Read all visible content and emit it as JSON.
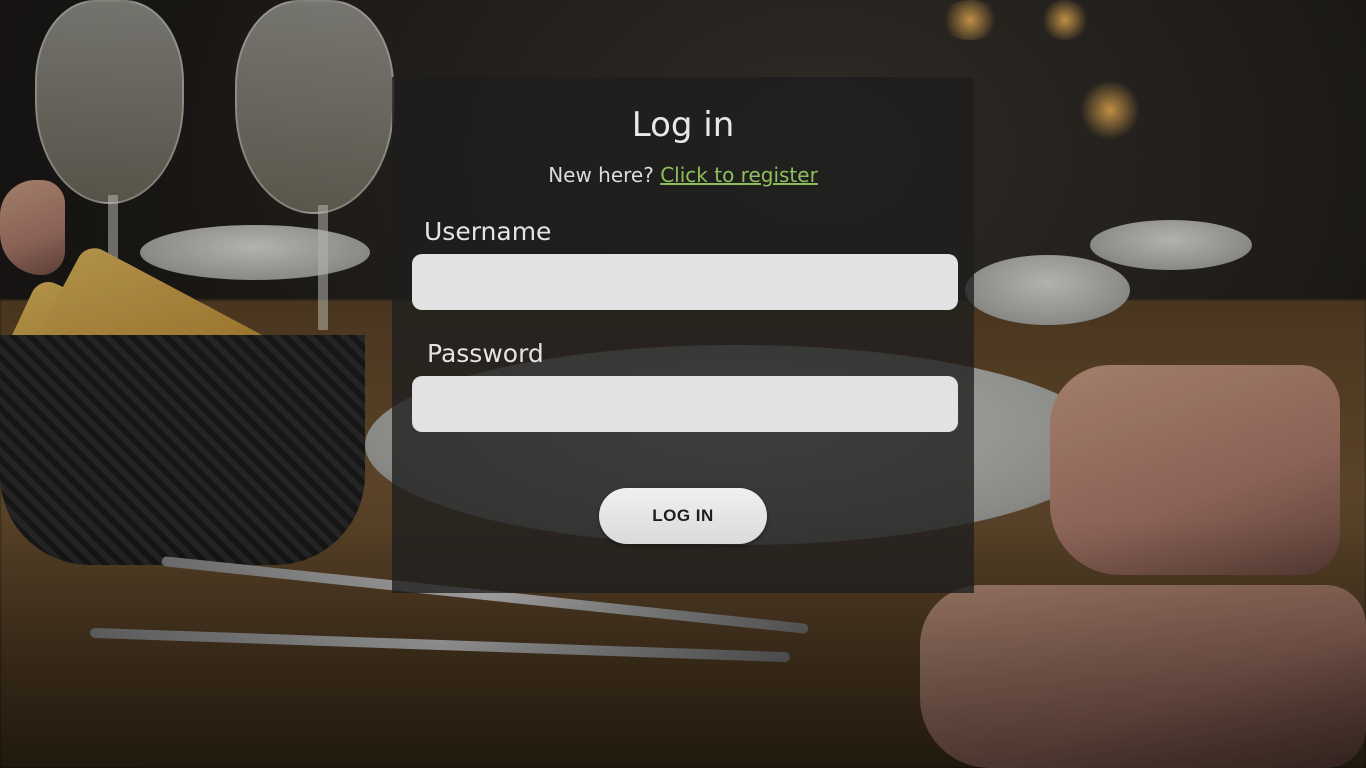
{
  "login": {
    "title": "Log in",
    "register_prompt": "New here?",
    "register_link": "Click to register",
    "username_label": "Username",
    "username_value": "",
    "password_label": "Password",
    "password_value": "",
    "submit_label": "LOG IN"
  },
  "colors": {
    "link": "#8fbf5c",
    "card_background": "rgba(30,30,30,0.78)",
    "input_background": "#e2e2e2",
    "button_background": "#e6e6e6"
  }
}
